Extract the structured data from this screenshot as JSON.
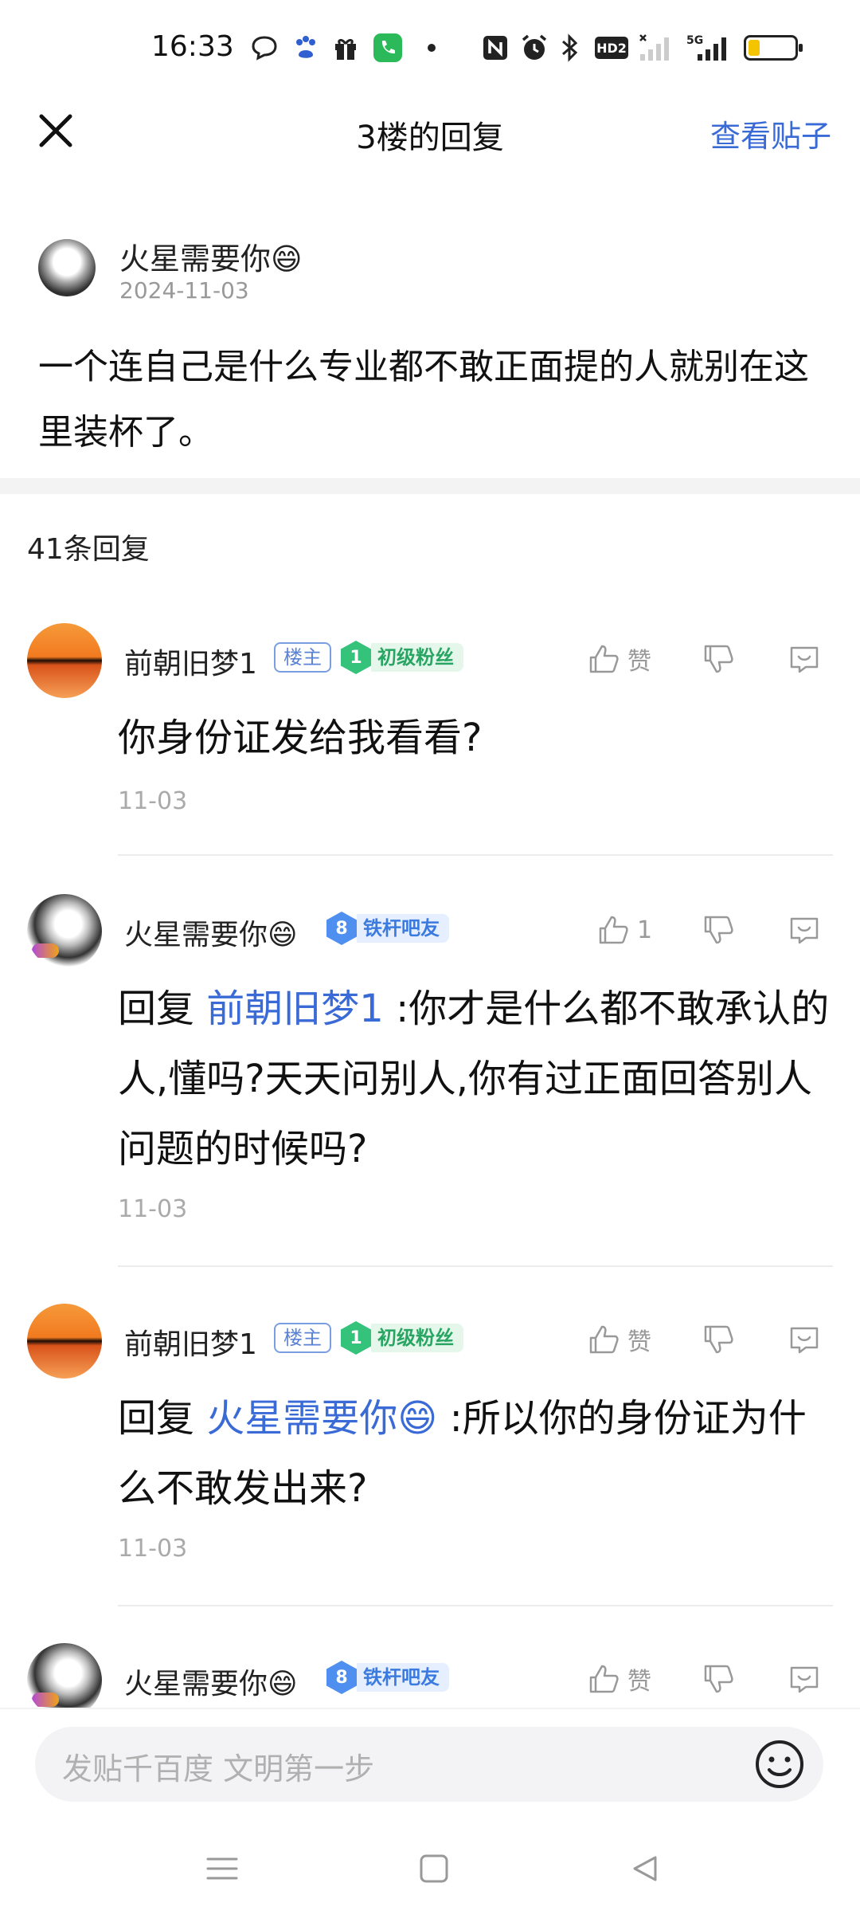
{
  "status_bar": {
    "time": "16:33",
    "icons": [
      "message-bubble-icon",
      "baidu-paw-icon",
      "gift-icon",
      "phone-icon",
      "dot-icon",
      "nfc-icon",
      "alarm-icon",
      "bluetooth-icon",
      "hd-icon",
      "signal-icon",
      "5g-signal-icon",
      "battery-icon"
    ],
    "hd_label": "HD2",
    "network_label": "5G",
    "battery_level": 0.25
  },
  "header": {
    "title": "3楼的回复",
    "view_post": "查看贴子"
  },
  "original_post": {
    "author": "火星需要你😄",
    "date": "2024-11-03",
    "text": "一个连自己是什么专业都不敢正面提的人就别在这里装杯了。"
  },
  "reply_count": "41条回复",
  "replies": [
    {
      "author": "前朝旧梦1",
      "owner_badge": "楼主",
      "level": "1",
      "level_name": "初级粉丝",
      "like_label": "赞",
      "reply_prefix": "",
      "mention": "",
      "text": "你身份证发给我看看?",
      "date": "11-03"
    },
    {
      "author": "火星需要你😄",
      "owner_badge": "",
      "level": "8",
      "level_name": "铁杆吧友",
      "like_label": "1",
      "reply_prefix": "回复 ",
      "mention": "前朝旧梦1",
      "text": " :你才是什么都不敢承认的人,懂吗?天天问别人,你有过正面回答别人问题的时候吗?",
      "date": "11-03"
    },
    {
      "author": "前朝旧梦1",
      "owner_badge": "楼主",
      "level": "1",
      "level_name": "初级粉丝",
      "like_label": "赞",
      "reply_prefix": "回复 ",
      "mention": "火星需要你😄",
      "text": " :所以你的身份证为什么不敢发出来?",
      "date": "11-03"
    },
    {
      "author": "火星需要你😄",
      "owner_badge": "",
      "level": "8",
      "level_name": "铁杆吧友",
      "like_label": "赞"
    }
  ],
  "input": {
    "placeholder": "发贴千百度 文明第一步"
  },
  "colors": {
    "accent": "#3a6ad6",
    "level_green": "#35c27a",
    "level_blue": "#4f8ff0"
  }
}
